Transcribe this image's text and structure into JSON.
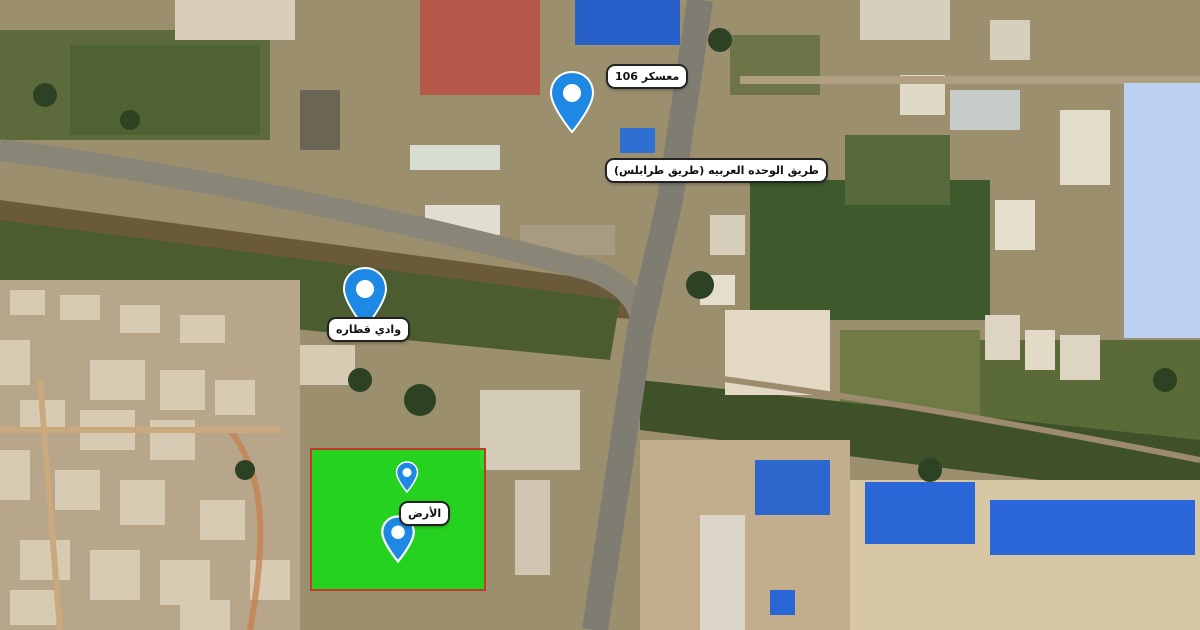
{
  "map": {
    "labels": {
      "camp": "معسكر 106",
      "road": "طريق الوحده العربيه (طريق طرابلس)",
      "wadi": "وادي قطاره",
      "land": "الأرض"
    },
    "colors": {
      "pin": "#1e88e5",
      "plot_fill": "#16dc16",
      "plot_border": "#c0392b",
      "panel": "#bcd0f2"
    },
    "icons": [
      "map-pin-icon"
    ]
  }
}
